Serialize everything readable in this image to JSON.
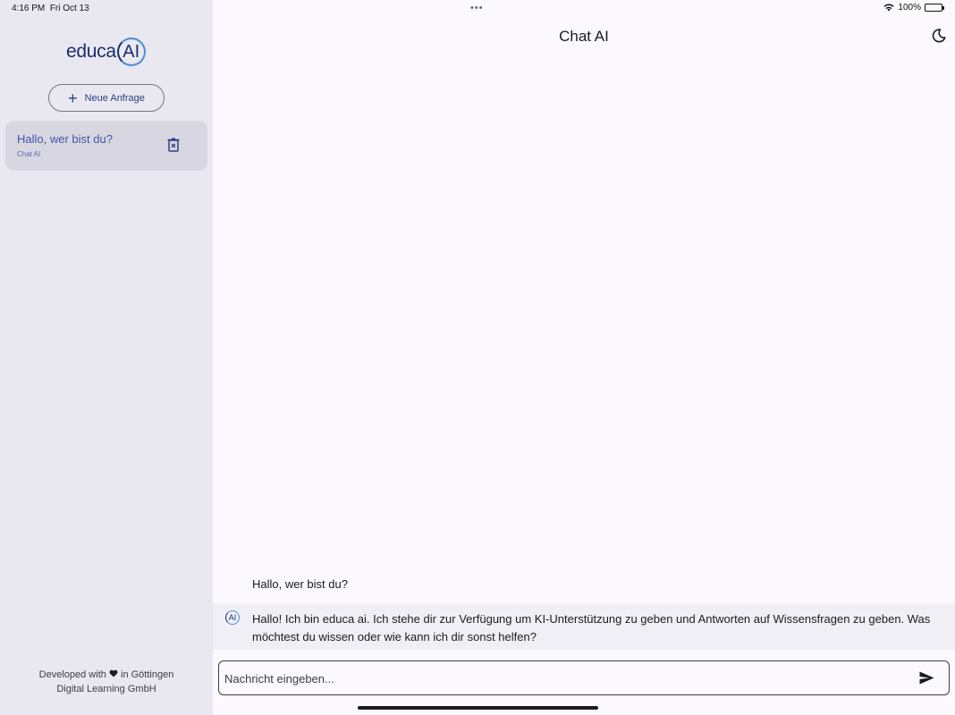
{
  "status_bar": {
    "time": "4:16 PM",
    "date": "Fri Oct 13",
    "dots": "•••",
    "battery": "100%"
  },
  "sidebar": {
    "logo_word": "educa",
    "logo_ai": "AI",
    "new_request_label": "Neue Anfrage",
    "conversations": [
      {
        "title": "Hallo, wer bist du?",
        "subtitle": "Chat AI"
      }
    ],
    "footer_line1_prefix": "Developed with",
    "footer_line1_suffix": "in Göttingen",
    "footer_line2": "Digital Learning GmbH"
  },
  "header": {
    "title": "Chat AI"
  },
  "chat": {
    "user_message": "Hallo, wer bist du?",
    "ai_avatar": "AI",
    "ai_message": "Hallo! Ich bin educa ai. Ich stehe dir zur Verfügung um KI-Unterstützung zu geben und Antworten auf Wissensfragen zu geben. Was möchtest du wissen oder wie kann ich dir sonst helfen?"
  },
  "composer": {
    "placeholder": "Nachricht eingeben..."
  },
  "colors": {
    "sidebar_bg": "#e9e7f0",
    "main_bg": "#fbf9fd",
    "accent": "#2d3f84",
    "selected_item_bg": "#d8d6e1"
  }
}
